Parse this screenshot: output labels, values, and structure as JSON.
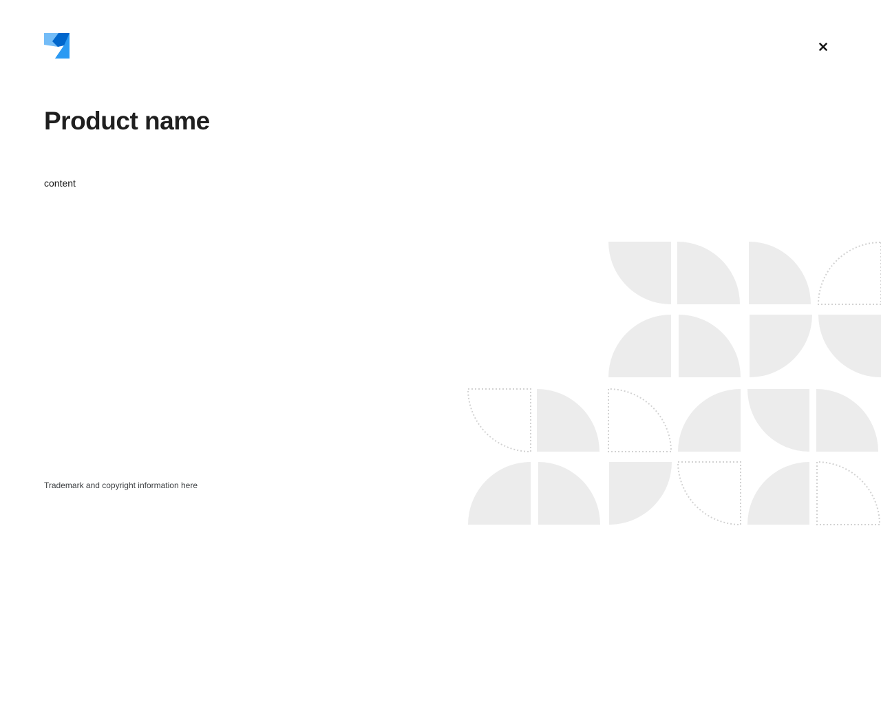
{
  "header": {
    "logo_icon": "brand-logo-icon",
    "close_icon": "close-icon",
    "close_label": "Close"
  },
  "main": {
    "product_name": "Product name",
    "content": "content"
  },
  "footer": {
    "trademark": "Trademark and copyright information here"
  },
  "colors": {
    "logo_light": "#73bcf7",
    "logo_mid": "#2b9af3",
    "logo_dark": "#0066cc",
    "pattern_fill": "#ececec",
    "pattern_dash": "#d2d2d2",
    "text_primary": "#151515"
  }
}
